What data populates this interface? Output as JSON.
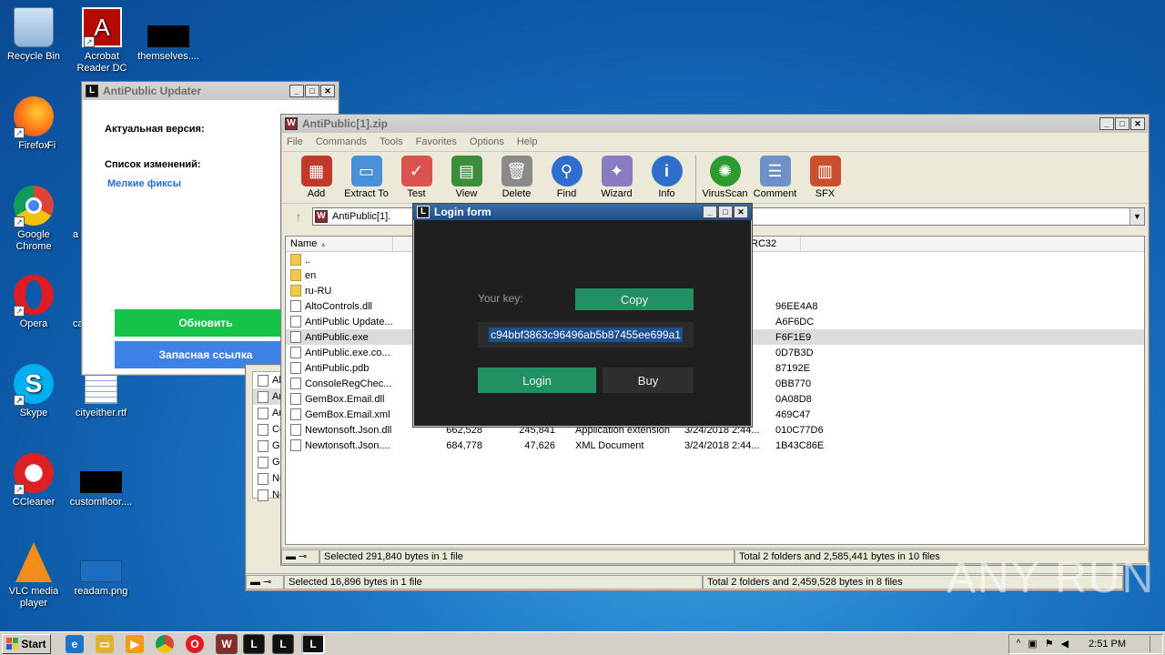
{
  "desktop": {
    "icons": [
      {
        "label": "Recycle Bin",
        "glyph": "🗑"
      },
      {
        "label": "Acrobat Reader DC",
        "glyph": "A"
      },
      {
        "label": "themselves....",
        "glyph": ""
      },
      {
        "label": "Firefox",
        "glyph": "◉"
      },
      {
        "label": "Fi",
        "glyph": ""
      },
      {
        "label": "Google Chrome",
        "glyph": "◎"
      },
      {
        "label": "a",
        "glyph": ""
      },
      {
        "label": "Opera",
        "glyph": "O"
      },
      {
        "label": "ca",
        "glyph": ""
      },
      {
        "label": "Skype",
        "glyph": "S"
      },
      {
        "label": "cityeither.rtf",
        "glyph": ""
      },
      {
        "label": "CCleaner",
        "glyph": "C"
      },
      {
        "label": "customfloor....",
        "glyph": ""
      },
      {
        "label": "VLC media player",
        "glyph": "▲"
      },
      {
        "label": "readam.png",
        "glyph": ""
      }
    ]
  },
  "updater": {
    "title": "AntiPublic Updater",
    "version_label": "Актуальная версия:",
    "changes_label": "Список изменений:",
    "changes_link": "Мелкие фиксы",
    "update_button": "Обновить",
    "backup_link_button": "Запасная ссылка"
  },
  "winrar_back": {
    "status_left": "Selected 16,896 bytes in 1 file",
    "status_right": "Total 2 folders and 2,459,528 bytes in 8 files",
    "rows": [
      "Al",
      "Ar",
      "An",
      "Co",
      "Ge",
      "Ge",
      "Ne",
      "Ne"
    ]
  },
  "winrar": {
    "title": "AntiPublic[1].zip",
    "menu": [
      "File",
      "Commands",
      "Tools",
      "Favorites",
      "Options",
      "Help"
    ],
    "toolbar": [
      {
        "label": "Add",
        "color": "#c0392b",
        "glyph": "▦"
      },
      {
        "label": "Extract To",
        "color": "#4a90d9",
        "glyph": "▭"
      },
      {
        "label": "Test",
        "color": "#d9534f",
        "glyph": "✓"
      },
      {
        "label": "View",
        "color": "#3c8d3c",
        "glyph": "▤"
      },
      {
        "label": "Delete",
        "color": "#8a8a8a",
        "glyph": "🗑"
      },
      {
        "label": "Find",
        "color": "#2e6fd0",
        "glyph": "⚲"
      },
      {
        "label": "Wizard",
        "color": "#8a7cc0",
        "glyph": "✦"
      },
      {
        "label": "Info",
        "color": "#2f6fc9",
        "glyph": "i"
      },
      {
        "label": "VirusScan",
        "color": "#2d9a2d",
        "glyph": "✺"
      },
      {
        "label": "Comment",
        "color": "#6f8fc7",
        "glyph": "☰"
      },
      {
        "label": "SFX",
        "color": "#c8502d",
        "glyph": "▥"
      }
    ],
    "path": "AntiPublic[1].",
    "columns": {
      "name": "Name",
      "crc": "RC32"
    },
    "files": [
      {
        "name": "..",
        "size": "",
        "packed": "",
        "type": "",
        "modified": "",
        "crc": "",
        "folder": true
      },
      {
        "name": "en",
        "size": "",
        "packed": "",
        "type": "",
        "modified": "",
        "crc": "",
        "folder": true
      },
      {
        "name": "ru-RU",
        "size": "",
        "packed": "",
        "type": "",
        "modified": "",
        "crc": "",
        "folder": true
      },
      {
        "name": "AltoControls.dll",
        "size": "",
        "packed": "",
        "type": "",
        "modified": "",
        "crc": "96EE4A8",
        "folder": false
      },
      {
        "name": "AntiPublic Update...",
        "size": "",
        "packed": "",
        "type": "",
        "modified": "",
        "crc": "A6F6DC",
        "folder": false
      },
      {
        "name": "AntiPublic.exe",
        "size": "",
        "packed": "",
        "type": "",
        "modified": "",
        "crc": "F6F1E9",
        "folder": false,
        "selected": true
      },
      {
        "name": "AntiPublic.exe.co...",
        "size": "",
        "packed": "",
        "type": "",
        "modified": "",
        "crc": "0D7B3D",
        "folder": false
      },
      {
        "name": "AntiPublic.pdb",
        "size": "",
        "packed": "",
        "type": "",
        "modified": "",
        "crc": "87192E",
        "folder": false
      },
      {
        "name": "ConsoleRegChec...",
        "size": "",
        "packed": "",
        "type": "",
        "modified": "",
        "crc": "0BB770",
        "folder": false
      },
      {
        "name": "GemBox.Email.dll",
        "size": "",
        "packed": "",
        "type": "",
        "modified": "",
        "crc": "0A08D8",
        "folder": false
      },
      {
        "name": "GemBox.Email.xml",
        "size": "",
        "packed": "",
        "type": "",
        "modified": "",
        "crc": "469C47",
        "folder": false
      },
      {
        "name": "Newtonsoft.Json.dll",
        "size": "662,528",
        "packed": "245,841",
        "type": "Application extension",
        "modified": "3/24/2018 2:44...",
        "crc": "010C77D6",
        "folder": false
      },
      {
        "name": "Newtonsoft.Json....",
        "size": "684,778",
        "packed": "47,626",
        "type": "XML Document",
        "modified": "3/24/2018 2:44...",
        "crc": "1B43C86E",
        "folder": false
      }
    ],
    "status_left": "Selected 291,840 bytes in 1 file",
    "status_right": "Total 2 folders and 2,585,441 bytes in 10 files"
  },
  "login": {
    "title": "Login form",
    "key_label": "Your key:",
    "copy_button": "Copy",
    "key_value": "c94bbf3863c96496ab5b87455ee699a1",
    "login_button": "Login",
    "buy_button": "Buy"
  },
  "taskbar": {
    "start_label": "Start",
    "clock": "2:51 PM"
  },
  "watermark": "ANY RUN",
  "colors": {
    "login_bg": "#1f1f1f",
    "login_green": "#239063",
    "updater_green": "#16c34a",
    "updater_blue": "#3f82e6"
  }
}
